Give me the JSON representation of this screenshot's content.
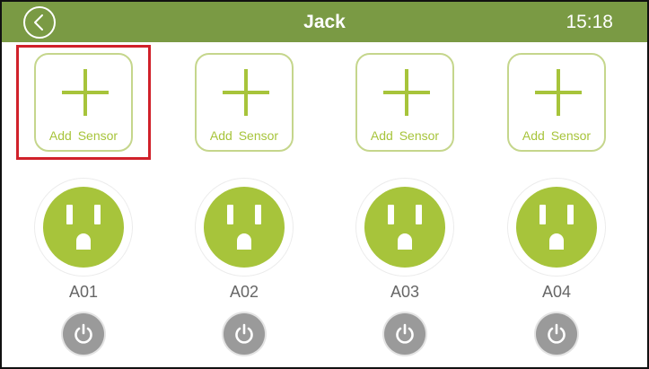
{
  "header": {
    "title": "Jack",
    "time": "15:18",
    "back_icon": "chevron-left-icon"
  },
  "colors": {
    "header_bg": "#7a9a44",
    "accent_green": "#a7c43b",
    "card_border": "#c5d68c",
    "selection_outline": "#d0212a",
    "power_button": "#9a9a9a",
    "label_gray": "#666666"
  },
  "add_sensor": {
    "label": "Add  Sensor",
    "icon": "plus-icon",
    "selected_index": 0
  },
  "sockets": [
    {
      "label": "A01",
      "icon": "outlet-icon",
      "power_icon": "power-icon"
    },
    {
      "label": "A02",
      "icon": "outlet-icon",
      "power_icon": "power-icon"
    },
    {
      "label": "A03",
      "icon": "outlet-icon",
      "power_icon": "power-icon"
    },
    {
      "label": "A04",
      "icon": "outlet-icon",
      "power_icon": "power-icon"
    }
  ]
}
